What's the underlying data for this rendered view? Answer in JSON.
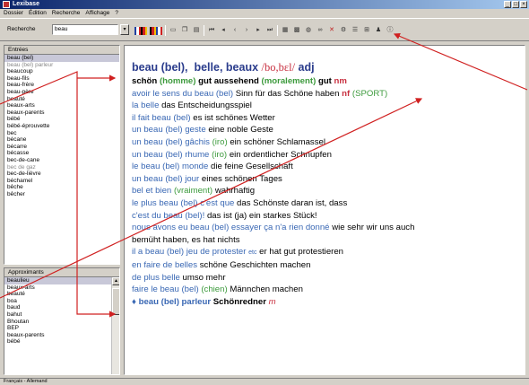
{
  "window": {
    "title": "Lexibase"
  },
  "menu": [
    "Dossier",
    "Édition",
    "Recherche",
    "Affichage",
    "?"
  ],
  "toolbar": {
    "search_label": "Recherche",
    "search_value": "beau"
  },
  "entries": {
    "header": "Entrées",
    "items": [
      "beau (bel)",
      "beau (bel) parleur",
      "beaucoup",
      "beau-fils",
      "beau-frère",
      "beau-père",
      "beauté",
      "beaux-arts",
      "beaux-parents",
      "bébé",
      "bébé-éprouvette",
      "bec",
      "bécane",
      "bécarre",
      "bécasse",
      "bec-de-cane",
      "bec de gaz",
      "bec-de-lièvre",
      "béchamel",
      "bêche",
      "bêcher"
    ]
  },
  "approx": {
    "header": "Approximants",
    "items": [
      "beaulieu",
      "beaux-arts",
      "beauté",
      "boa",
      "baud",
      "bahut",
      "Bhoutan",
      "BEP",
      "beaux-parents",
      "bébé"
    ]
  },
  "article": {
    "headword": "beau (bel),",
    "headword_forms": "belle, beaux",
    "pron": "/bo,bɛl/",
    "pos": "adj",
    "senses": [
      {
        "fr": "schön",
        "lab": "(homme)",
        "de": "gut aussehend",
        "lab2": "(moralement)",
        "de2": "gut",
        "gram": "nm"
      },
      {
        "fr": "avoir le sens du beau (bel)",
        "de": "Sinn für das Schöne haben",
        "gram": "nf",
        "lab": "(SPORT)"
      },
      {
        "fr": "la belle",
        "de": "das Entscheidungsspiel"
      },
      {
        "fr": "il fait beau (bel)",
        "de": "es ist schönes Wetter"
      },
      {
        "fr": "un beau (bel) geste",
        "de": "eine noble Geste"
      },
      {
        "fr": "un beau (bel) gâchis",
        "lab": "(iro)",
        "de": "ein schöner Schlamassel"
      },
      {
        "fr": "un beau (bel) rhume",
        "lab": "(iro)",
        "de": "ein ordentlicher Schnupfen"
      },
      {
        "fr": "le beau (bel) monde",
        "de": "die feine Gesellschaft"
      },
      {
        "fr": "un beau (bel) jour",
        "de": "eines schönen Tages"
      },
      {
        "fr": "bel et bien",
        "lab": "(vraiment)",
        "de": "wahrhaftig"
      },
      {
        "fr": "le plus beau (bel) c'est que",
        "de": "das Schönste daran ist, dass"
      },
      {
        "fr": "c'est du beau (bel)!",
        "de": "das ist (ja) ein starkes Stück!"
      },
      {
        "fr": "nous avons eu beau (bel) essayer ça n'a rien donné",
        "de": "wie sehr wir uns auch"
      },
      {
        "de": "bemüht haben, es hat nichts"
      },
      {
        "fr": "il a beau (bel) jeu de protester",
        "etc": "etc",
        "de": "er hat gut protestieren"
      },
      {
        "fr": "en faire de belles",
        "de": "schöne Geschichten machen"
      },
      {
        "fr": "de plus belle",
        "de": "umso mehr"
      },
      {
        "fr": "faire le beau (bel)",
        "lab": "(chien)",
        "de": "Männchen machen"
      }
    ],
    "compound": {
      "bullet": "♦",
      "fr": "beau (bel) parleur",
      "de": "Schönredner",
      "gram": "m"
    }
  },
  "statusbar": {
    "text": "Français - Allemand"
  },
  "colors": {
    "french": "#3a68b4",
    "label": "#3c9a3c",
    "grammar": "#c83040",
    "headword": "#2a3c8c",
    "arrow": "#d02020"
  }
}
